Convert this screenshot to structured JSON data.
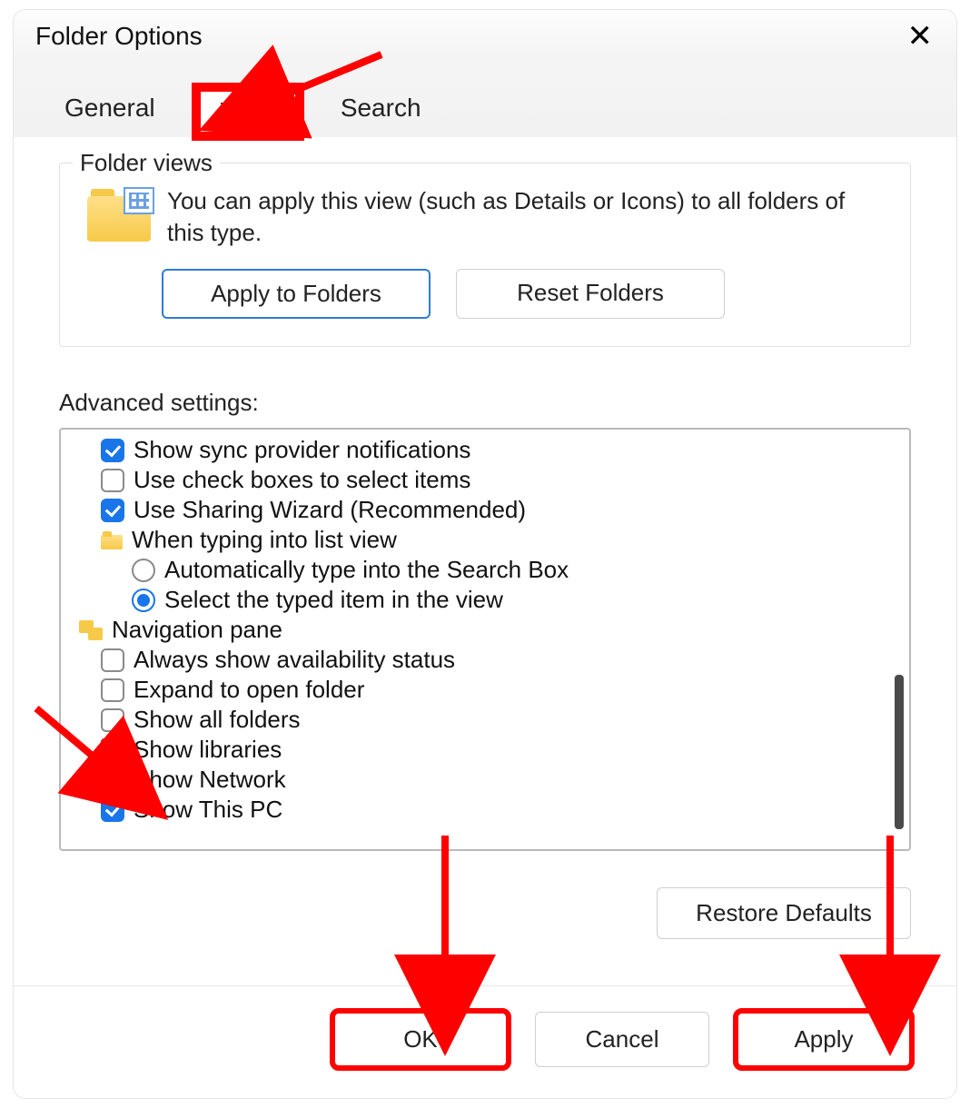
{
  "window": {
    "title": "Folder Options"
  },
  "tabs": {
    "general": "General",
    "view": "View",
    "search": "Search"
  },
  "folder_views": {
    "group_label": "Folder views",
    "desc": "You can apply this view (such as Details or Icons) to all folders of this type.",
    "apply_btn": "Apply to Folders",
    "reset_btn": "Reset Folders"
  },
  "advanced": {
    "label": "Advanced settings:",
    "items": {
      "show_sync": "Show sync provider notifications",
      "use_checkboxes": "Use check boxes to select items",
      "sharing_wizard": "Use Sharing Wizard (Recommended)",
      "typing_group": "When typing into list view",
      "typing_search": "Automatically type into the Search Box",
      "typing_select": "Select the typed item in the view",
      "nav_group": "Navigation pane",
      "nav_availability": "Always show availability status",
      "nav_expand": "Expand to open folder",
      "nav_showall": "Show all folders",
      "nav_libraries": "Show libraries",
      "nav_network": "Show Network",
      "nav_thispc": "Show This PC"
    }
  },
  "restore_btn": "Restore Defaults",
  "footer": {
    "ok": "OK",
    "cancel": "Cancel",
    "apply": "Apply"
  }
}
